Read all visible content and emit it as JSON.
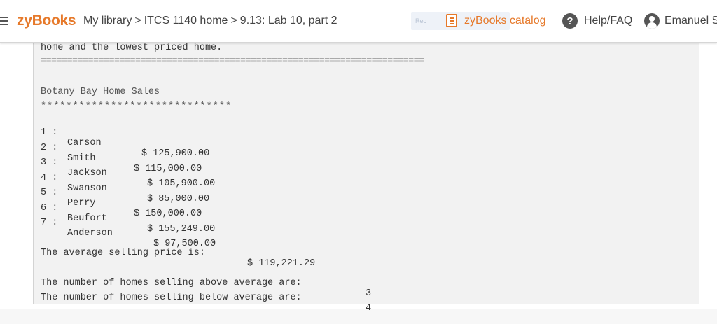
{
  "header": {
    "logo": "zyBooks",
    "breadcrumb": [
      "My library",
      "ITCS 1140 home",
      "9.13: Lab 10, part 2"
    ],
    "breadcrumb_sep": ">",
    "catalog_faded": "Rec",
    "catalog_label": "zyBooks catalog",
    "help_label": "Help/FAQ",
    "help_icon": "?",
    "user_name": "Emanuel Sa"
  },
  "console": {
    "intro_line": "home and the lowest priced home.",
    "separator": "=========================================================================",
    "title": "Botany Bay Home Sales",
    "stars": "******************************",
    "rows": [
      {
        "num": "1 :",
        "name": "Carson",
        "price": "$ 125,900.00"
      },
      {
        "num": "2 :",
        "name": "Smith",
        "price": "$ 115,000.00"
      },
      {
        "num": "3 :",
        "name": "Jackson",
        "price": "$ 105,900.00"
      },
      {
        "num": "4 :",
        "name": "Swanson",
        "price": "$ 85,000.00"
      },
      {
        "num": "5 :",
        "name": "Perry",
        "price": "$ 150,000.00"
      },
      {
        "num": "6 :",
        "name": "Beufort",
        "price": "$ 155,249.00"
      },
      {
        "num": "7 :",
        "name": "Anderson",
        "price": "$ 97,500.00"
      }
    ],
    "average_label": "The average selling price is:",
    "average_value": "$ 119,221.29",
    "above_label": "The number of homes selling above average are:",
    "above_value": "3",
    "below_label": "The number of homes selling below average are:",
    "below_value": "4"
  }
}
